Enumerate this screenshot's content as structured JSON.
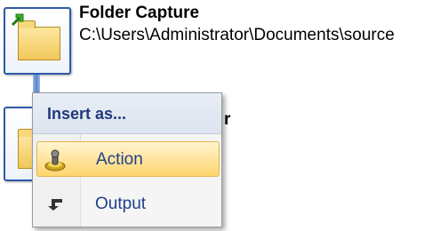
{
  "workflow": {
    "node1": {
      "title": "Folder Capture",
      "path": "C:\\Users\\Administrator\\Documents\\source",
      "icon": "folder-capture-icon"
    },
    "node2": {
      "title_visible_fragment": "r",
      "icon": "folder-icon"
    }
  },
  "context_menu": {
    "header": "Insert as...",
    "items": [
      {
        "label": "Action",
        "icon": "action-gear-icon",
        "highlighted": true
      },
      {
        "label": "Output",
        "icon": "output-arrow-icon",
        "highlighted": false
      }
    ]
  },
  "colors": {
    "menu_label": "#1f3f8a",
    "menu_header": "#203a7a",
    "highlight": "#ffe39a",
    "node_border": "#2f5aa8",
    "folder": "#f1c85a"
  }
}
